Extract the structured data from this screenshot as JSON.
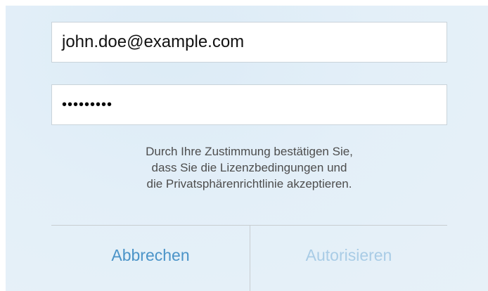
{
  "login": {
    "email_value": "john.doe@example.com",
    "password_masked": "•••••••••"
  },
  "consent": {
    "line1": "Durch Ihre Zustimmung bestätigen Sie,",
    "line2": "dass Sie die Lizenzbedingungen und",
    "line3": "die Privatsphärenrichtlinie akzeptieren."
  },
  "buttons": {
    "cancel_label": "Abbrechen",
    "authorize_label": "Autorisieren"
  },
  "colors": {
    "link_blue": "#4b94c8",
    "disabled_blue": "#a9cce6",
    "background": "#e3eff8"
  }
}
